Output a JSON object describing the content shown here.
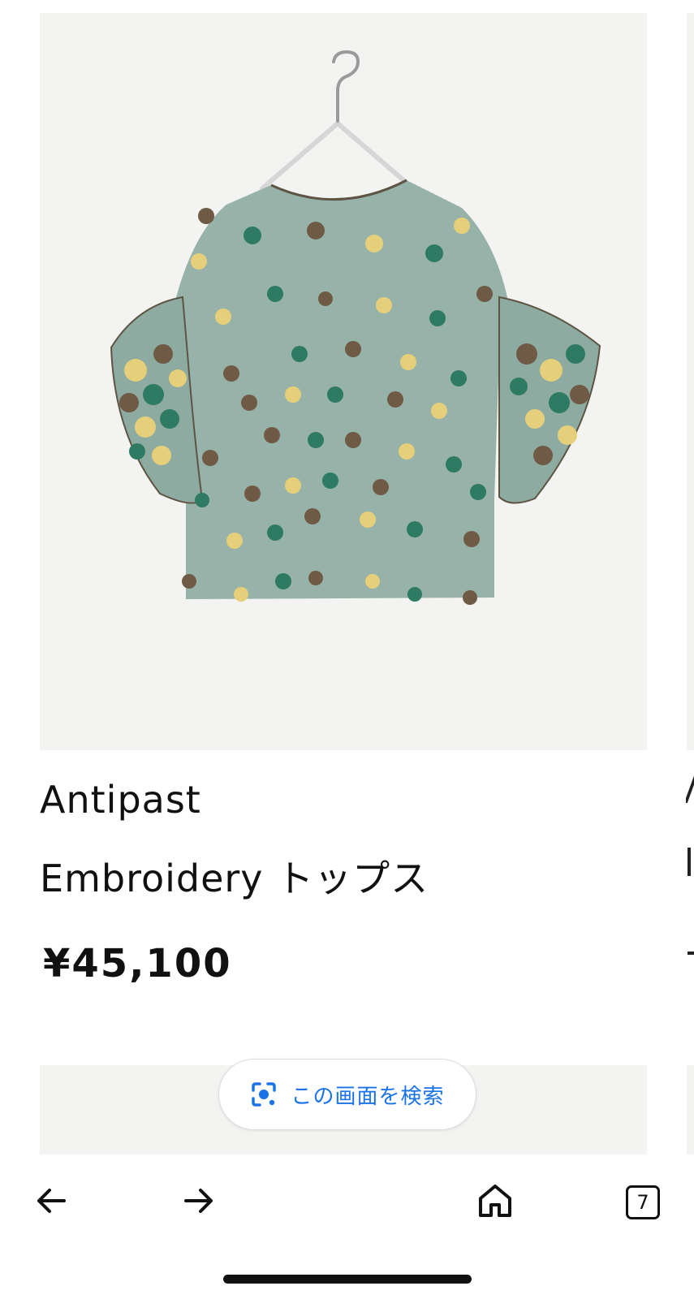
{
  "product": {
    "brand": "Antipast",
    "name": "Embroidery トップス",
    "price": "¥45,100",
    "image_icon": "floral-blouse-product-photo"
  },
  "lens_search": {
    "label": "この画面を検索",
    "icon": "google-lens-icon",
    "accent_color": "#1a73e8"
  },
  "bottom_nav": {
    "back_icon": "arrow-left-icon",
    "forward_icon": "arrow-right-icon",
    "home_icon": "home-icon",
    "tab_count": "7"
  }
}
